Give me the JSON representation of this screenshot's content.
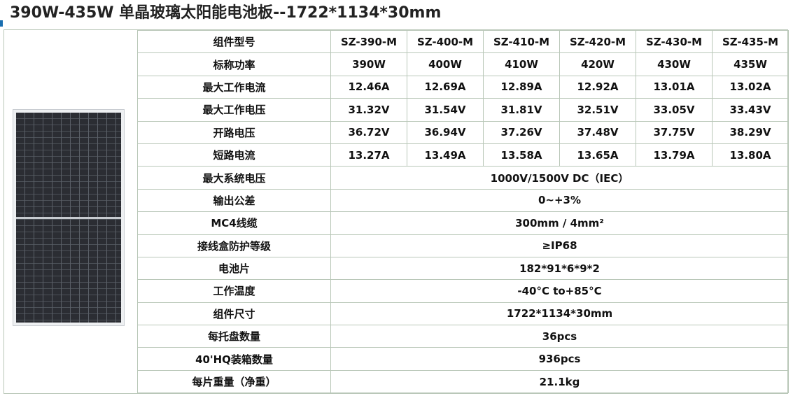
{
  "title": "390W-435W 单晶玻璃太阳能电池板--1722*1134*30mm",
  "panel_image": "solar-panel-image",
  "rows6": [
    {
      "label": "组件型号",
      "values": [
        "SZ-390-M",
        "SZ-400-M",
        "SZ-410-M",
        "SZ-420-M",
        "SZ-430-M",
        "SZ-435-M"
      ]
    },
    {
      "label": "标称功率",
      "values": [
        "390W",
        "400W",
        "410W",
        "420W",
        "430W",
        "435W"
      ]
    },
    {
      "label": "最大工作电流",
      "values": [
        "12.46A",
        "12.69A",
        "12.89A",
        "12.92A",
        "13.01A",
        "13.02A"
      ]
    },
    {
      "label": "最大工作电压",
      "values": [
        "31.32V",
        "31.54V",
        "31.81V",
        "32.51V",
        "33.05V",
        "33.43V"
      ]
    },
    {
      "label": "开路电压",
      "values": [
        "36.72V",
        "36.94V",
        "37.26V",
        "37.48V",
        "37.75V",
        "38.29V"
      ]
    },
    {
      "label": "短路电流",
      "values": [
        "13.27A",
        "13.49A",
        "13.58A",
        "13.65A",
        "13.79A",
        "13.80A"
      ]
    }
  ],
  "rows1": [
    {
      "label": "最大系统电压",
      "value": "1000V/1500V DC（IEC）"
    },
    {
      "label": "输出公差",
      "value": "0~+3%"
    },
    {
      "label": "MC4线缆",
      "value": "300mm / 4mm²"
    },
    {
      "label": "接线盒防护等级",
      "value": "≥IP68"
    },
    {
      "label": "电池片",
      "value": "182*91*6*9*2"
    },
    {
      "label": "工作温度",
      "value": "-40°C to+85°C"
    },
    {
      "label": "组件尺寸",
      "value": "1722*1134*30mm"
    },
    {
      "label": "每托盘数量",
      "value": "36pcs"
    },
    {
      "label": "40'HQ装箱数量",
      "value": "936pcs"
    },
    {
      "label": "每片重量（净重）",
      "value": "21.1kg"
    }
  ]
}
